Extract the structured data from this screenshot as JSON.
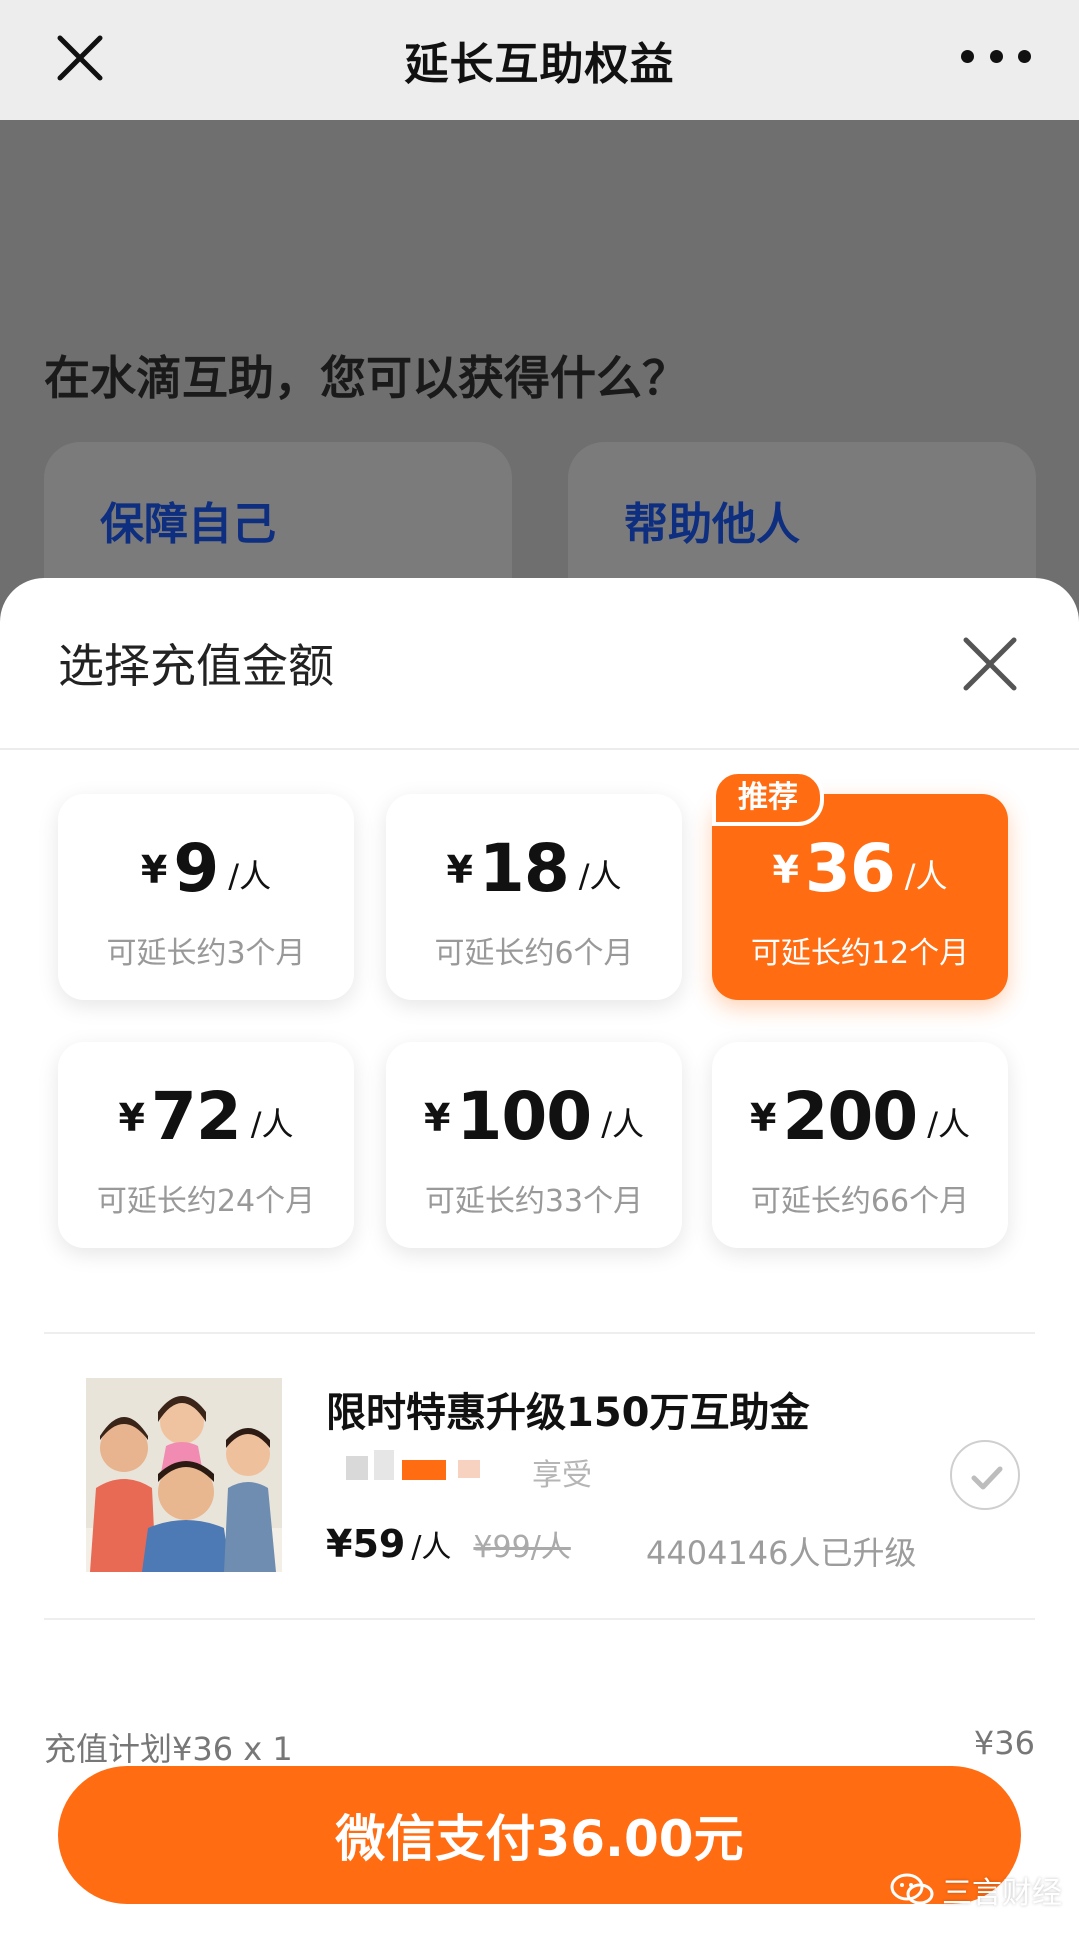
{
  "nav": {
    "title": "延长互助权益"
  },
  "background": {
    "question": "在水滴互助，您可以获得什么？",
    "cards": [
      "保障自己",
      "帮助他人"
    ]
  },
  "sheet": {
    "title": "选择充值金额",
    "badge": "推荐",
    "currency": "¥",
    "unit": "/人",
    "amounts": [
      {
        "value": "9",
        "extend": "可延长约3个月",
        "selected": false
      },
      {
        "value": "18",
        "extend": "可延长约6个月",
        "selected": false
      },
      {
        "value": "36",
        "extend": "可延长约12个月",
        "selected": true
      },
      {
        "value": "72",
        "extend": "可延长约24个月",
        "selected": false
      },
      {
        "value": "100",
        "extend": "可延长约33个月",
        "selected": false
      },
      {
        "value": "200",
        "extend": "可延长约66个月",
        "selected": false
      }
    ],
    "promo": {
      "title": "限时特惠升级150万互助金",
      "subtitle_visible": "享受",
      "price": "¥59",
      "unit": "/人",
      "original_price": "¥99/人",
      "upgraded_count": "4404146人已升级"
    },
    "plan_label": "充值计划¥36 x 1",
    "plan_total": "¥36",
    "pay_button": "微信支付36.00元"
  },
  "watermark": "三言财经",
  "colors": {
    "accent": "#ff6c12",
    "overlay": "#6f6f6f",
    "link_blue": "#0e2e80"
  }
}
